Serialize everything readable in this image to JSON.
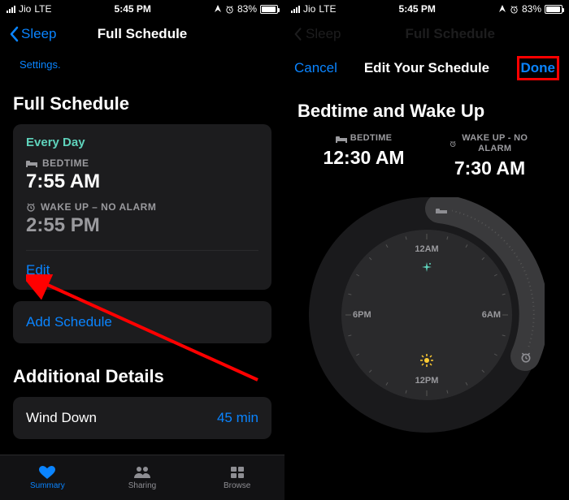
{
  "status": {
    "carrier": "Jio",
    "network": "LTE",
    "time": "5:45 PM",
    "battery_pct": "83%"
  },
  "left": {
    "nav_back": "Sleep",
    "nav_title": "Full Schedule",
    "settings_link": "Settings.",
    "section1_title": "Full Schedule",
    "schedule_name": "Every Day",
    "bedtime_label": "BEDTIME",
    "bedtime_value": "7:55 AM",
    "wakeup_label": "WAKE UP – NO ALARM",
    "wakeup_value": "2:55 PM",
    "edit_label": "Edit",
    "add_label": "Add Schedule",
    "section2_title": "Additional Details",
    "winddown_label": "Wind Down",
    "winddown_value": "45 min",
    "tab_summary": "Summary",
    "tab_sharing": "Sharing",
    "tab_browse": "Browse"
  },
  "right": {
    "dim_back": "Sleep",
    "dim_title": "Full Schedule",
    "cancel": "Cancel",
    "title": "Edit Your Schedule",
    "done": "Done",
    "section_title": "Bedtime and Wake Up",
    "bedtime_label": "BEDTIME",
    "bedtime_value": "12:30 AM",
    "wakeup_label": "WAKE UP - NO ALARM",
    "wakeup_value": "7:30 AM",
    "dial_12am": "12AM",
    "dial_6am": "6AM",
    "dial_12pm": "12PM",
    "dial_6pm": "6PM"
  }
}
